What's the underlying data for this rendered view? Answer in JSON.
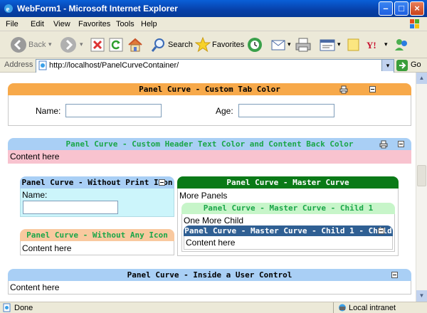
{
  "window": {
    "title": "WebForm1 - Microsoft Internet Explorer"
  },
  "menu": [
    "File",
    "Edit",
    "View",
    "Favorites",
    "Tools",
    "Help"
  ],
  "toolbar": {
    "back": "Back",
    "search": "Search",
    "favorites": "Favorites"
  },
  "address": {
    "label": "Address",
    "url": "http://localhost/PanelCurveContainer/",
    "go": "Go"
  },
  "panels": {
    "tab_color": {
      "title": "Panel Curve - Custom Tab Color",
      "name_label": "Name:",
      "age_label": "Age:",
      "name_value": "",
      "age_value": "",
      "header_color": "#f7a94a"
    },
    "header_text": {
      "title": "Panel Curve - Custom Header Text Color and Content Back Color",
      "content": "Content here",
      "header_color": "#a9cff5",
      "text_color": "#1aa648",
      "content_color": "#f8c3cf"
    },
    "no_print": {
      "title": "Panel Curve - Without Print Icon",
      "name_label": "Name:",
      "name_value": "",
      "header_color": "#a9cff5",
      "content_color": "#ccf5fb"
    },
    "no_icon": {
      "title": "Panel Curve - Without Any Icon",
      "content": "Content here",
      "header_color": "#f9c99f",
      "text_color": "#1aa648"
    },
    "master": {
      "title": "Panel Curve - Master Curve",
      "content": "More Panels",
      "header_color": "#0a7a17",
      "text_color": "#ffffff"
    },
    "child1": {
      "title": "Panel Curve - Master Curve - Child 1",
      "content": "One More Child",
      "header_color": "#c7f5c9",
      "text_color": "#1aa648"
    },
    "child11": {
      "title": "Panel Curve - Master Curve - Child 1 - Child 1",
      "content": "Content here",
      "header_color": "#2f5f93",
      "text_color": "#ffffff"
    },
    "user_control": {
      "title": "Panel Curve - Inside a User Control",
      "content": "Content here",
      "header_color": "#a9cff5"
    }
  },
  "status": {
    "left": "Done",
    "zone": "Local intranet"
  }
}
